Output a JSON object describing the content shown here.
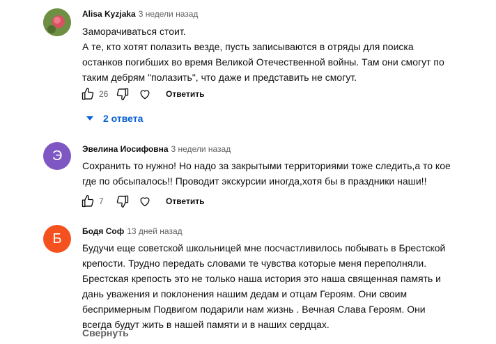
{
  "comments": [
    {
      "author": "Alisa Kyzjaka",
      "time": "3 недели назад",
      "lines": [
        "Заморачиваться стоит.",
        "А те, кто хотят полазить везде, пусть записываются в отряды для поиска",
        "останков погибших во время Великой Отечественной войны. Там они смогут по",
        "таким дебрям \"полазить\", что даже и представить не смогут."
      ],
      "likes": "26",
      "reply_label": "Ответить",
      "replies_label": "2 ответа",
      "avatar_icon": "photo-avatar"
    },
    {
      "author": "Эвелина Иосифовна",
      "time": "3 недели назад",
      "avatar_letter": "Э",
      "avatar_color": "#7e57c2",
      "lines": [
        "Сохранить то нужно! Но надо за закрытыми территориями тоже следить,а то кое",
        "где по обсыпалось!! Проводит экскурсии иногда,хотя бы в праздники наши!!"
      ],
      "likes": "7",
      "reply_label": "Ответить"
    },
    {
      "author": "Бодя Соф",
      "time": "13 дней назад",
      "avatar_letter": "Б",
      "avatar_color": "#f4511e",
      "lines": [
        "Будучи еще советской школьницей мне посчастливилось  побывать в Брестской",
        "крепости. Трудно передать словами те чувства которые меня переполняли.",
        "Брестская  крепость это не только наша история это наша священная память и",
        "дань уважения и поклонения нашим дедам и отцам Героям. Они своим",
        "беспримерным Подвигом подарили нам жизнь . Вечная Слава  Героям. Они",
        "всегда будут жить в нашей памяти и в наших сердцах."
      ],
      "collapse_label": "Свернуть"
    }
  ],
  "colors": {
    "link": "#065fd4",
    "muted": "#606060",
    "text": "#0f0f0f"
  }
}
